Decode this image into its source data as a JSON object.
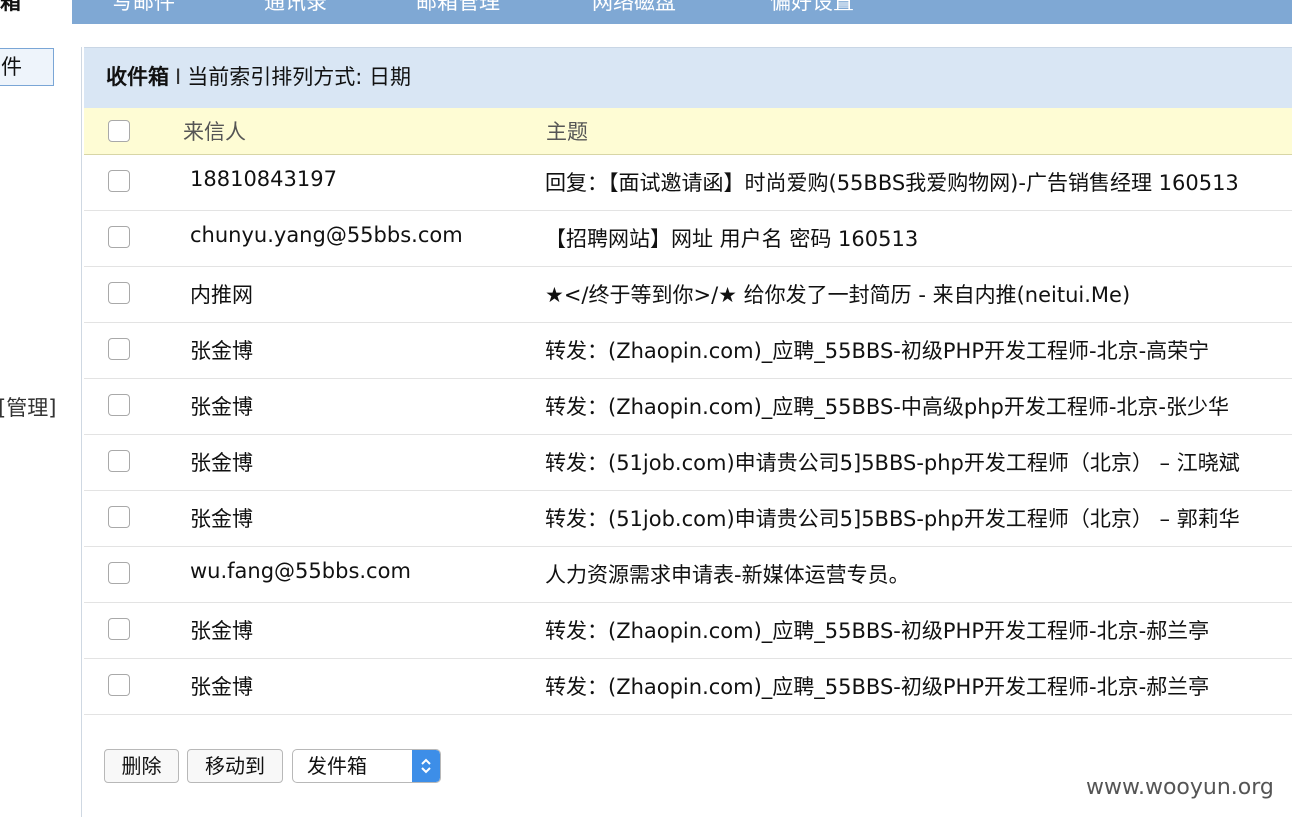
{
  "top": {
    "left_title": "箱",
    "nav": [
      "写邮件",
      "通讯录",
      "邮箱管理",
      "网络磁盘",
      "偏好设置"
    ]
  },
  "sidebar": {
    "box_label": "件",
    "manage_label": "[管理]"
  },
  "panel": {
    "folder": "收件箱",
    "separator": "I",
    "sort_text": "当前索引排列方式: 日期"
  },
  "columns": {
    "from": "来信人",
    "subject": "主题"
  },
  "emails": [
    {
      "from": "18810843197",
      "subject": "回复：【面试邀请函】时尚爱购(55BBS我爱购物网)-广告销售经理 160513"
    },
    {
      "from": "chunyu.yang@55bbs.com",
      "subject": "【招聘网站】网址 用户名 密码 160513"
    },
    {
      "from": "内推网",
      "subject": "★</终于等到你>/★ 给你发了一封简历 - 来自内推(neitui.Me)"
    },
    {
      "from": "张金博",
      "subject": "转发：(Zhaopin.com)_应聘_55BBS-初级PHP开发工程师-北京-高荣宁"
    },
    {
      "from": "张金博",
      "subject": "转发：(Zhaopin.com)_应聘_55BBS-中高级php开发工程师-北京-张少华"
    },
    {
      "from": "张金博",
      "subject": "转发：(51job.com)申请贵公司5]5BBS-php开发工程师（北京） – 江晓斌"
    },
    {
      "from": "张金博",
      "subject": "转发：(51job.com)申请贵公司5]5BBS-php开发工程师（北京） – 郭莉华"
    },
    {
      "from": "wu.fang@55bbs.com",
      "subject": "人力资源需求申请表-新媒体运营专员。"
    },
    {
      "from": "张金博",
      "subject": "转发：(Zhaopin.com)_应聘_55BBS-初级PHP开发工程师-北京-郝兰亭"
    },
    {
      "from": "张金博",
      "subject": "转发：(Zhaopin.com)_应聘_55BBS-初级PHP开发工程师-北京-郝兰亭"
    }
  ],
  "actions": {
    "delete_label": "删除",
    "move_label": "移动到",
    "folder_select_value": "发件箱"
  },
  "watermark": "www.wooyun.org",
  "colors": {
    "nav_bg": "#7fa8d4",
    "header_bg": "#d9e6f4",
    "column_header_bg": "#fefcd4",
    "select_arrow": "#3d8ee8"
  }
}
